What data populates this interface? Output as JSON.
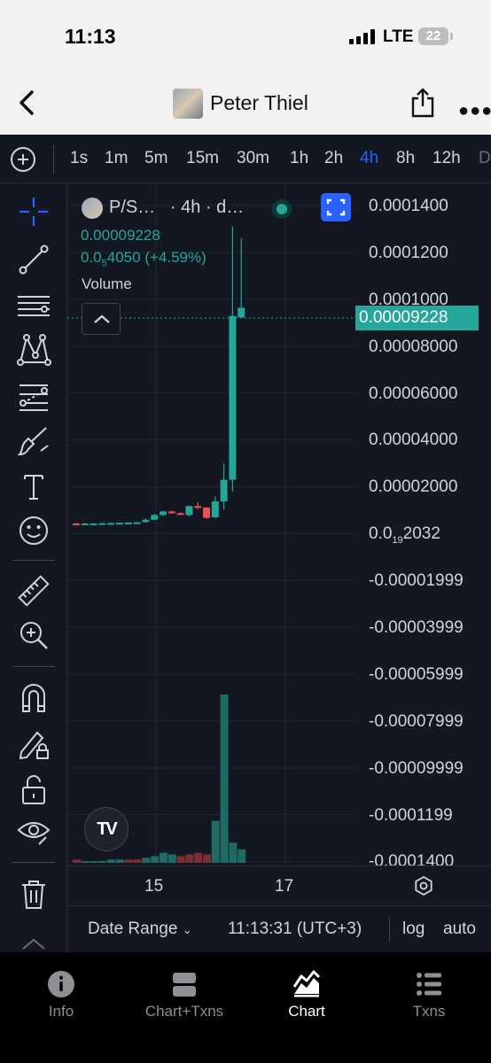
{
  "status_bar": {
    "time": "11:13",
    "network": "LTE",
    "battery": "22"
  },
  "nav": {
    "title": "Peter Thiel",
    "back_icon": "chevron-left-icon",
    "share_icon": "share-icon",
    "more_icon": "more-horizontal-icon"
  },
  "timeframes": {
    "items": [
      "1s",
      "1m",
      "5m",
      "15m",
      "30m",
      "1h",
      "2h",
      "4h",
      "8h",
      "12h",
      "D"
    ],
    "active": "4h"
  },
  "tools": [
    "crosshair-icon",
    "trend-line-icon",
    "horizontal-lines-icon",
    "pattern-icon",
    "fib-icon",
    "brush-icon",
    "text-icon",
    "emoji-icon",
    "ruler-icon",
    "zoom-in-icon",
    "magnet-icon",
    "lock-drawing-icon",
    "unlock-icon",
    "eye-icon",
    "trash-icon",
    "chevron-up-icon"
  ],
  "legend": {
    "symbol": "P/S…",
    "interval": "· 4h · d…",
    "price": "0.00009228",
    "change_prefix": "0.0",
    "change_sub": "5",
    "change_rest": "4050 (+4.59%)",
    "volume_label": "Volume"
  },
  "y_axis": {
    "labels": [
      "0.0001400",
      "0.0001200",
      "0.0001000",
      "0.00008000",
      "0.00006000",
      "0.00004000",
      "0.00002000",
      "-0.00001999",
      "-0.00003999",
      "-0.00005999",
      "-0.00007999",
      "-0.00009999",
      "-0.0001199",
      "-0.0001400"
    ],
    "zero_prefix": "0.0",
    "zero_sub": "19",
    "zero_rest": "2032",
    "last_price": "0.00009228"
  },
  "x_axis": {
    "labels": [
      "15",
      "17"
    ]
  },
  "bottom_bar": {
    "date_range": "Date Range",
    "clock": "11:13:31 (UTC+3)",
    "log": "log",
    "auto": "auto"
  },
  "tabs": [
    {
      "label": "Info",
      "icon": "info-icon"
    },
    {
      "label": "Chart+Txns",
      "icon": "split-view-icon"
    },
    {
      "label": "Chart",
      "icon": "chart-icon",
      "active": true
    },
    {
      "label": "Txns",
      "icon": "list-icon"
    }
  ],
  "colors": {
    "up": "#26a69a",
    "down": "#ef5350",
    "accent": "#2962ff",
    "background": "#131722"
  },
  "chart_data": {
    "type": "candlestick",
    "interval": "4h",
    "candles": [
      {
        "o": 4e-07,
        "h": 6e-07,
        "l": 2e-07,
        "c": 3e-07,
        "dir": "down"
      },
      {
        "o": 3e-07,
        "h": 5e-07,
        "l": 2e-07,
        "c": 4e-07,
        "dir": "up"
      },
      {
        "o": 4e-07,
        "h": 5e-07,
        "l": 3e-07,
        "c": 4e-07,
        "dir": "up"
      },
      {
        "o": 4e-07,
        "h": 6e-07,
        "l": 3e-07,
        "c": 5e-07,
        "dir": "up"
      },
      {
        "o": 5e-07,
        "h": 7e-07,
        "l": 4e-07,
        "c": 6e-07,
        "dir": "up"
      },
      {
        "o": 6e-07,
        "h": 8e-07,
        "l": 5e-07,
        "c": 7e-07,
        "dir": "up"
      },
      {
        "o": 7e-07,
        "h": 9e-07,
        "l": 6e-07,
        "c": 8e-07,
        "dir": "up"
      },
      {
        "o": 8e-07,
        "h": 1e-06,
        "l": 7e-07,
        "c": 9e-07,
        "dir": "up"
      },
      {
        "o": 1e-06,
        "h": 2.5e-06,
        "l": 8e-07,
        "c": 2e-06,
        "dir": "up"
      },
      {
        "o": 2e-06,
        "h": 4.5e-06,
        "l": 1.8e-06,
        "c": 4e-06,
        "dir": "up"
      },
      {
        "o": 4e-06,
        "h": 5.8e-06,
        "l": 3.5e-06,
        "c": 5.5e-06,
        "dir": "up"
      },
      {
        "o": 5.5e-06,
        "h": 5.8e-06,
        "l": 4.5e-06,
        "c": 4.8e-06,
        "dir": "down"
      },
      {
        "o": 4.8e-06,
        "h": 5.2e-06,
        "l": 4e-06,
        "c": 4.2e-06,
        "dir": "down"
      },
      {
        "o": 4e-06,
        "h": 8e-06,
        "l": 3.5e-06,
        "c": 7.8e-06,
        "dir": "up"
      },
      {
        "o": 7.8e-06,
        "h": 9.5e-06,
        "l": 6.5e-06,
        "c": 7.2e-06,
        "dir": "down"
      },
      {
        "o": 7.2e-06,
        "h": 7.3e-06,
        "l": 2.5e-06,
        "c": 2.8e-06,
        "dir": "down"
      },
      {
        "o": 3e-06,
        "h": 1.2e-05,
        "l": 2.8e-06,
        "c": 9.8e-06,
        "dir": "up"
      },
      {
        "o": 9.8e-06,
        "h": 2.6e-05,
        "l": 6.5e-06,
        "c": 1.9e-05,
        "dir": "up"
      },
      {
        "o": 1.9e-05,
        "h": 0.000127,
        "l": 1.4e-05,
        "c": 8.88e-05,
        "dir": "up"
      },
      {
        "o": 8.82e-05,
        "h": 0.000122,
        "l": 8.8e-05,
        "c": 9.23e-05,
        "dir": "up"
      }
    ],
    "volume": [
      {
        "v": 2,
        "dir": "down"
      },
      {
        "v": 1,
        "dir": "up"
      },
      {
        "v": 1,
        "dir": "up"
      },
      {
        "v": 1,
        "dir": "up"
      },
      {
        "v": 2,
        "dir": "up"
      },
      {
        "v": 2,
        "dir": "up"
      },
      {
        "v": 2,
        "dir": "down"
      },
      {
        "v": 2,
        "dir": "down"
      },
      {
        "v": 3,
        "dir": "up"
      },
      {
        "v": 4,
        "dir": "up"
      },
      {
        "v": 6,
        "dir": "up"
      },
      {
        "v": 5,
        "dir": "up"
      },
      {
        "v": 4,
        "dir": "down"
      },
      {
        "v": 5,
        "dir": "down"
      },
      {
        "v": 6,
        "dir": "down"
      },
      {
        "v": 5,
        "dir": "down"
      },
      {
        "v": 25,
        "dir": "up"
      },
      {
        "v": 100,
        "dir": "up"
      },
      {
        "v": 12,
        "dir": "up"
      },
      {
        "v": 8,
        "dir": "up"
      }
    ],
    "ylim": [
      -0.00014,
      0.00014
    ],
    "x_tick_labels": [
      "15",
      "17"
    ],
    "grid": true
  }
}
